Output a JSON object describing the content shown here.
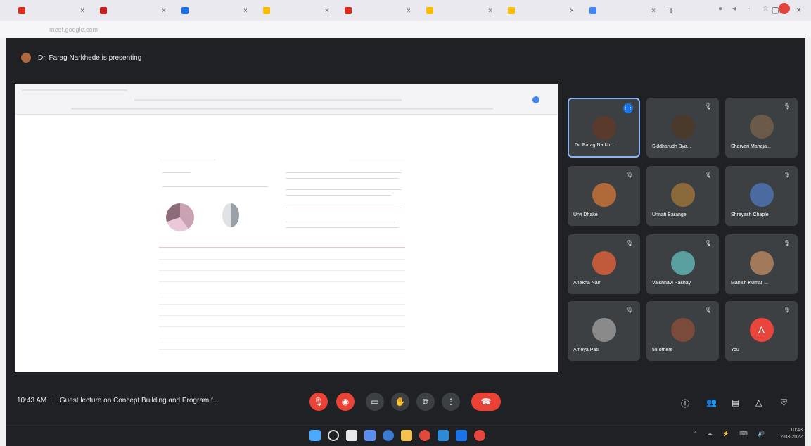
{
  "browser": {
    "tabs": [
      {
        "label": "",
        "fav": "#d93025"
      },
      {
        "label": "",
        "fav": "#c5221f"
      },
      {
        "label": "",
        "fav": "#1a73e8"
      },
      {
        "label": "",
        "fav": "#fbbc04"
      },
      {
        "label": "",
        "fav": "#d93025"
      },
      {
        "label": "",
        "fav": "#fbbc04"
      },
      {
        "label": "",
        "fav": "#fbbc04"
      },
      {
        "label": "",
        "fav": "#4285f4"
      }
    ],
    "url": "meet.google.com",
    "new_tab": "+",
    "close_glyph": "×"
  },
  "presenter": {
    "text": "Dr. Farag Narkhede is presenting"
  },
  "shared_doc": {
    "heading": "",
    "link_text": ""
  },
  "participants": [
    {
      "name": "Dr. Parag Narkh...",
      "active": true,
      "avatar_color": "#5b3a2e",
      "speaking": true
    },
    {
      "name": "Siddharudh Bya...",
      "active": false,
      "avatar_color": "#4a3a2c"
    },
    {
      "name": "Sharvari Mahaja...",
      "active": false,
      "avatar_color": "#6b5a4a"
    },
    {
      "name": "Urvi Dhake",
      "active": false,
      "avatar_color": "#b06a3a"
    },
    {
      "name": "Unnati Barange",
      "active": false,
      "avatar_color": "#8a6a3a"
    },
    {
      "name": "Shreyash Chaple",
      "active": false,
      "avatar_color": "#4a6aa0"
    },
    {
      "name": "Anakha Nair",
      "active": false,
      "avatar_color": "#c05a3a"
    },
    {
      "name": "Vaishnavi Pashay",
      "active": false,
      "avatar_color": "#5aa0a0"
    },
    {
      "name": "Manish Kumar ...",
      "active": false,
      "avatar_color": "#a07a5a"
    },
    {
      "name": "Ameya Patil",
      "active": false,
      "avatar_color": "#8a8a8a"
    },
    {
      "name": "58 others",
      "active": false,
      "avatar_color": "#7a4a3a"
    },
    {
      "name": "You",
      "active": false,
      "you": true,
      "initial": "A"
    }
  ],
  "bottom": {
    "time": "10:43 AM",
    "meeting_title": "Guest lecture on Concept Building and Program f..."
  },
  "clock": {
    "time": "10:43",
    "date": "12-03-2022"
  },
  "colors": {
    "meet_bg": "#202124",
    "tile_bg": "#3c4043",
    "accent_red": "#ea4335",
    "active_border": "#8ab4f8"
  }
}
